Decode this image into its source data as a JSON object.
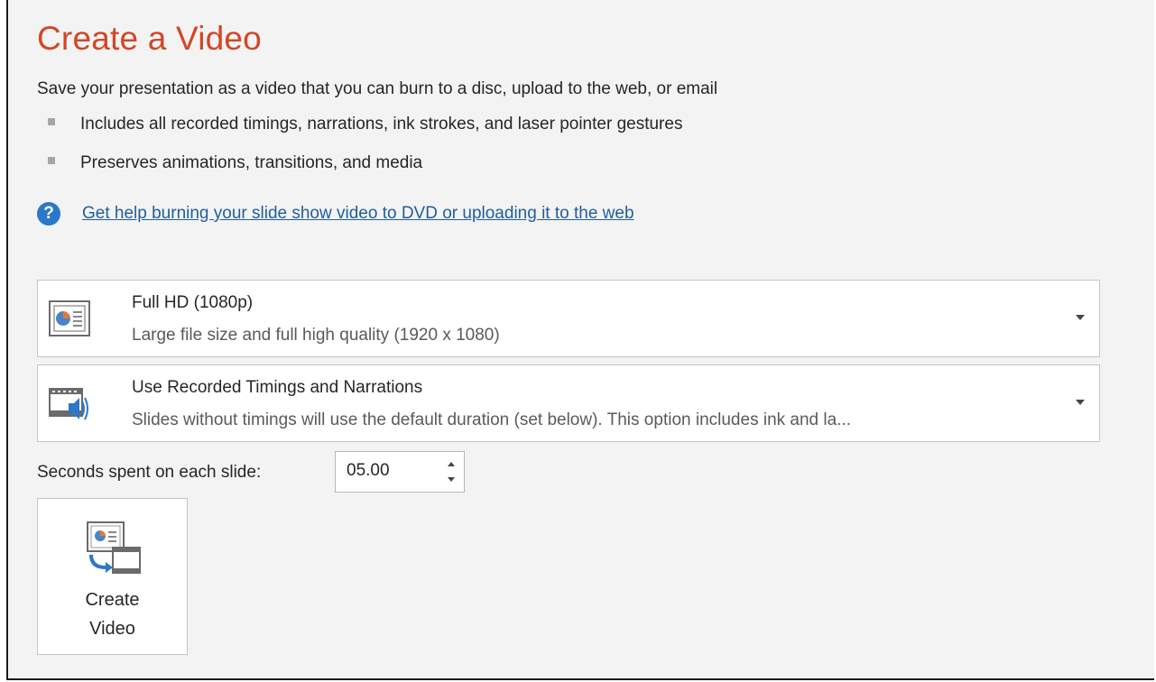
{
  "title": "Create a Video",
  "description": "Save your presentation as a video that you can burn to a disc, upload to the web, or email",
  "bullets": [
    "Includes all recorded timings, narrations, ink strokes, and laser pointer gestures",
    "Preserves animations, transitions, and media"
  ],
  "help": {
    "icon": "question-circle-icon",
    "link_text": "Get help burning your slide show video to DVD or uploading it to the web"
  },
  "quality_dropdown": {
    "icon": "presentation-quality-icon",
    "title": "Full HD (1080p)",
    "subtitle": "Large file size and full high quality (1920 x 1080)"
  },
  "timings_dropdown": {
    "icon": "timings-narration-icon",
    "title": "Use Recorded Timings and Narrations",
    "subtitle": "Slides without timings will use the default duration (set below). This option includes ink and la..."
  },
  "seconds": {
    "label": "Seconds spent on each slide:",
    "value": "05.00"
  },
  "create_button": {
    "icon": "create-video-icon",
    "line1": "Create",
    "line2": "Video"
  },
  "colors": {
    "title": "#d24726",
    "link": "#1f5e9e",
    "help_icon": "#2a78c7",
    "background": "#f3f3f3"
  }
}
